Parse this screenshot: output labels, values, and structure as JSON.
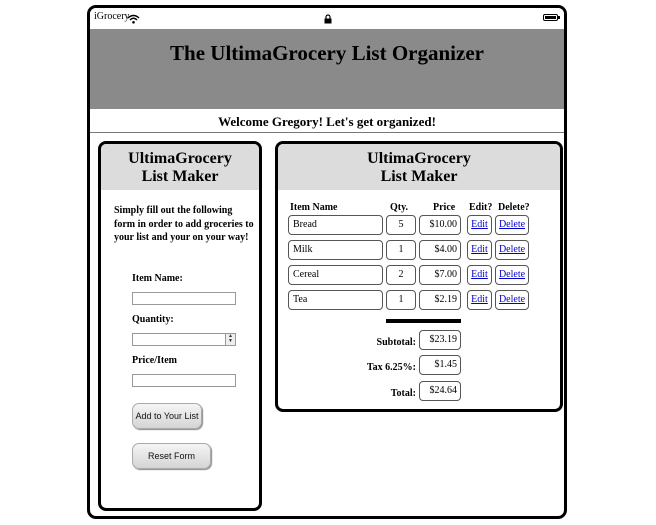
{
  "status_bar": {
    "carrier": "iGrocery",
    "wifi_icon": "wifi-icon",
    "lock_icon": "lock-icon",
    "battery_icon": "battery-icon"
  },
  "header": {
    "title": "The UltimaGrocery List Organizer"
  },
  "welcome": "Welcome Gregory! Let's get organized!",
  "form_panel": {
    "title_line1": "UltimaGrocery",
    "title_line2": "List Maker",
    "instructions": "Simply fill out the following form in order to add groceries to your list and your on your way!",
    "item_name_label": "Item Name:",
    "item_name_value": "",
    "quantity_label": "Quantity:",
    "quantity_value": "",
    "price_label": "Price/Item",
    "price_value": "",
    "add_button": "Add to Your List",
    "reset_button": "Reset Form"
  },
  "list_panel": {
    "title_line1": "UltimaGrocery",
    "title_line2": "List Maker",
    "columns": [
      "Item Name",
      "Qty.",
      "Price",
      "Edit?",
      "Delete?"
    ],
    "items": [
      {
        "name": "Bread",
        "qty": "5",
        "price": "$10.00",
        "edit": "Edit",
        "delete": "Delete"
      },
      {
        "name": "Milk",
        "qty": "1",
        "price": "$4.00",
        "edit": "Edit",
        "delete": "Delete"
      },
      {
        "name": "Cereal",
        "qty": "2",
        "price": "$7.00",
        "edit": "Edit",
        "delete": "Delete"
      },
      {
        "name": "Tea",
        "qty": "1",
        "price": "$2.19",
        "edit": "Edit",
        "delete": "Delete"
      }
    ],
    "subtotal_label": "Subtotal:",
    "subtotal_value": "$23.19",
    "tax_label": "Tax 6.25%:",
    "tax_value": "$1.45",
    "total_label": "Total:",
    "total_value": "$24.64"
  },
  "colors": {
    "header_bg": "#8a8a8a",
    "panel_head_bg": "#dcdcdc",
    "link": "#0000cc"
  }
}
